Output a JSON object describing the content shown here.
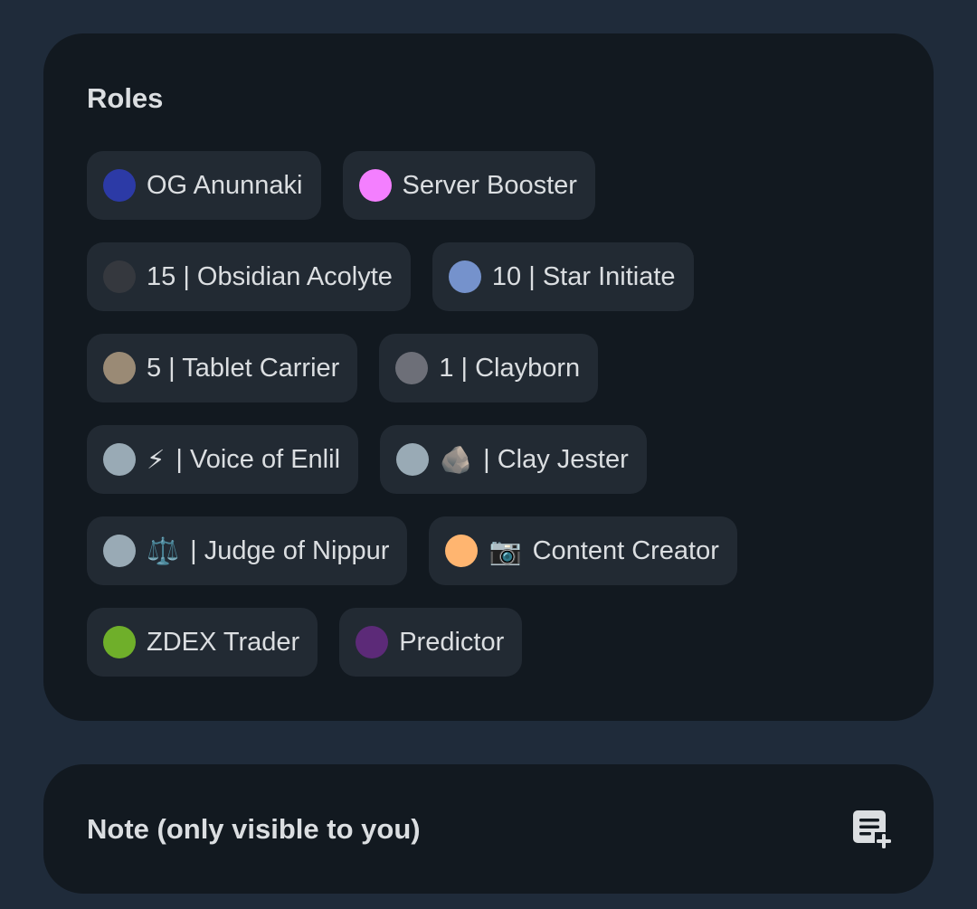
{
  "roles": {
    "title": "Roles",
    "items": [
      {
        "label": "OG Anunnaki",
        "color": "#2c3aa6",
        "emoji": ""
      },
      {
        "label": "Server Booster",
        "color": "#f47fff",
        "emoji": ""
      },
      {
        "label": "15 | Obsidian Acolyte",
        "color": "#35383e",
        "emoji": ""
      },
      {
        "label": "10 | Star Initiate",
        "color": "#7592cc",
        "emoji": ""
      },
      {
        "label": "5 | Tablet Carrier",
        "color": "#9a8a75",
        "emoji": ""
      },
      {
        "label": "1 | Clayborn",
        "color": "#6d6f78",
        "emoji": ""
      },
      {
        "label": "| Voice of Enlil",
        "color": "#99aab5",
        "emoji": "⚡"
      },
      {
        "label": "| Clay Jester",
        "color": "#99aab5",
        "emoji": "🪨"
      },
      {
        "label": "| Judge of Nippur",
        "color": "#99aab5",
        "emoji": "⚖️"
      },
      {
        "label": "Content Creator",
        "color": "#ffb570",
        "emoji": "📷"
      },
      {
        "label": "ZDEX Trader",
        "color": "#6faf2a",
        "emoji": ""
      },
      {
        "label": "Predictor",
        "color": "#5c2a78",
        "emoji": ""
      }
    ]
  },
  "note": {
    "label": "Note (only visible to you)",
    "icon": "add-note-icon"
  }
}
